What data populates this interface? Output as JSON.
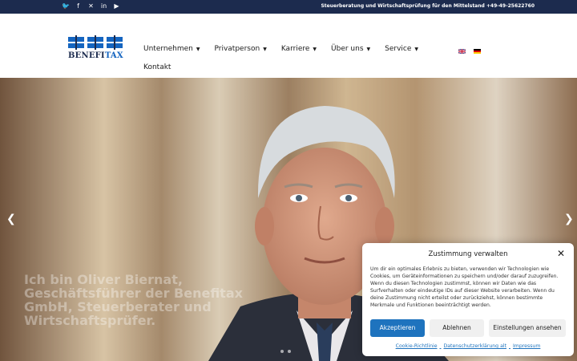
{
  "topbar": {
    "social": [
      {
        "icon": "twitter-icon",
        "glyph": "🐦"
      },
      {
        "icon": "facebook-icon",
        "glyph": "f"
      },
      {
        "icon": "xing-icon",
        "glyph": "✕"
      },
      {
        "icon": "linkedin-icon",
        "glyph": "in"
      },
      {
        "icon": "youtube-icon",
        "glyph": "▶"
      }
    ],
    "tagline": "Steuerberatung und Wirtschaftsprüfung für den Mittelstand +49-49-25622760"
  },
  "logo": {
    "part1": "BENEFI",
    "part2": "TAX"
  },
  "nav": {
    "items": [
      {
        "label": "Unternehmen"
      },
      {
        "label": "Privatperson"
      },
      {
        "label": "Karriere"
      },
      {
        "label": "Über uns"
      },
      {
        "label": "Service"
      }
    ],
    "kontakt": "Kontakt"
  },
  "hero": {
    "caption": "Ich bin Oliver Biernat, Geschäftsführer der Benefitax GmbH, Steuerberater und Wirtschaftsprüfer."
  },
  "cookie": {
    "title": "Zustimmung verwalten",
    "body": "Um dir ein optimales Erlebnis zu bieten, verwenden wir Technologien wie Cookies, um Geräteinformationen zu speichern und/oder darauf zuzugreifen. Wenn du diesen Technologien zustimmst, können wir Daten wie das Surfverhalten oder eindeutige IDs auf dieser Website verarbeiten. Wenn du deine Zustimmung nicht erteilst oder zurückziehst, können bestimmte Merkmale und Funktionen beeinträchtigt werden.",
    "accept": "Akzeptieren",
    "deny": "Ablehnen",
    "settings": "Einstellungen ansehen",
    "links": [
      "Cookie-Richtlinie",
      "Datenschutzerklärung alt",
      "Impressum"
    ]
  },
  "colors": {
    "navy": "#1c2b4e",
    "accent": "#1e73be"
  }
}
